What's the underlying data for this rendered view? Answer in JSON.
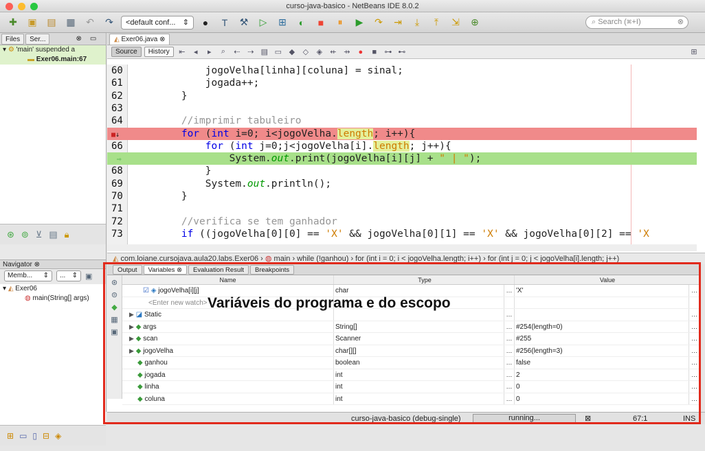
{
  "window": {
    "title": "curso-java-basico - NetBeans IDE 8.0.2"
  },
  "toolbar": {
    "config_label": "<default conf...",
    "search_placeholder": "Search (⌘+I)"
  },
  "left": {
    "tabs": [
      "Files",
      "Ser..."
    ],
    "debug_rows": [
      "'main' suspended a",
      "Exer06.main:67"
    ],
    "navigator_title": "Navigator",
    "navigator_filter": "Memb...",
    "navigator_dots": "...",
    "nav_items": [
      "Exer06",
      "main(String[] args)"
    ]
  },
  "editor": {
    "tab": "Exer06.java",
    "source_label": "Source",
    "history_label": "History",
    "lines": [
      {
        "n": "60",
        "t": "            jogoVelha[linha][coluna] = sinal;"
      },
      {
        "n": "61",
        "t": "            jogada++;"
      },
      {
        "n": "62",
        "t": "        }"
      },
      {
        "n": "63",
        "t": ""
      },
      {
        "n": "64",
        "t": "        //imprimir tabuleiro"
      },
      {
        "n": "",
        "t": "        for (int i=0; i<jogoVelha.length; i++){"
      },
      {
        "n": "66",
        "t": "            for (int j=0;j<jogoVelha[i].length; j++){"
      },
      {
        "n": "",
        "t": "                System.out.print(jogoVelha[i][j] + \" | \");"
      },
      {
        "n": "68",
        "t": "            }"
      },
      {
        "n": "69",
        "t": "            System.out.println();"
      },
      {
        "n": "70",
        "t": "        }"
      },
      {
        "n": "71",
        "t": ""
      },
      {
        "n": "72",
        "t": "        //verifica se tem ganhador"
      },
      {
        "n": "73",
        "t": "        if ((jogoVelha[0][0] == 'X' && jogoVelha[0][1] == 'X' && jogoVelha[0][2] == 'X"
      }
    ]
  },
  "breadcrumb": [
    "com.loiane.cursojava.aula20.labs.Exer06",
    "main",
    "while (!ganhou)",
    "for (int i = 0; i < jogoVelha.length; i++)",
    "for (int j = 0; j < jogoVelha[i].length; j++)"
  ],
  "bottom": {
    "tabs": [
      "Output",
      "Variables",
      "Evaluation Result",
      "Breakpoints"
    ],
    "headers": {
      "name": "Name",
      "type": "Type",
      "value": "Value"
    },
    "watch_placeholder": "<Enter new watch>",
    "rows": [
      {
        "name": "jogoVelha[i][j]",
        "type": "char",
        "value": "'X'"
      },
      {
        "name": "Static",
        "type": "",
        "value": ""
      },
      {
        "name": "args",
        "type": "String[]",
        "value": "#254(length=0)"
      },
      {
        "name": "scan",
        "type": "Scanner",
        "value": "#255"
      },
      {
        "name": "jogoVelha",
        "type": "char[][]",
        "value": "#256(length=3)"
      },
      {
        "name": "ganhou",
        "type": "boolean",
        "value": "false"
      },
      {
        "name": "jogada",
        "type": "int",
        "value": "2"
      },
      {
        "name": "linha",
        "type": "int",
        "value": "0"
      },
      {
        "name": "coluna",
        "type": "int",
        "value": "0"
      }
    ]
  },
  "status": {
    "project": "curso-java-basico (debug-single)",
    "state": "running...",
    "position": "67:1",
    "mode": "INS"
  },
  "annotation": "Variáveis do programa e do escopo",
  "colors": {
    "breakpoint_line": "#f08080",
    "current_line": "#a8e08a",
    "annotation_border": "#e12a1c"
  }
}
